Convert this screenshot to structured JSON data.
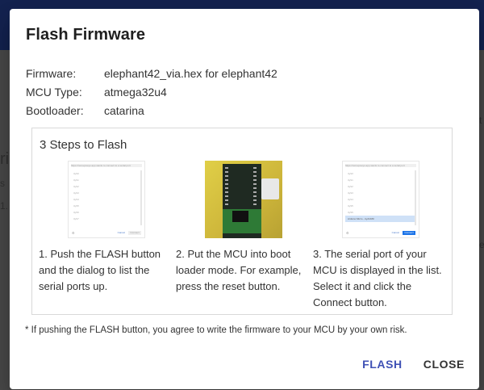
{
  "dialog": {
    "title": "Flash Firmware",
    "info": [
      {
        "label": "Firmware:",
        "value": "elephant42_via.hex for elephant42"
      },
      {
        "label": "MCU Type:",
        "value": "atmega32u4"
      },
      {
        "label": "Bootloader:",
        "value": "catarina"
      }
    ],
    "steps_title": "3 Steps to Flash",
    "steps": [
      {
        "text": "1. Push the FLASH button and the dialog to list the serial ports up."
      },
      {
        "text": "2. Put the MCU into boot loader mode. For example, press the reset button."
      },
      {
        "text": "3. The serial port of your MCU is displayed in the list. Select it and click the Connect button."
      }
    ],
    "disclaimer": "* If pushing the FLASH button, you agree to write the firmware to your MCU by your own risk.",
    "flash_label": "FLASH",
    "close_label": "CLOSE"
  },
  "colors": {
    "primary": "#3f51b5",
    "appbar": "#1e3478"
  }
}
